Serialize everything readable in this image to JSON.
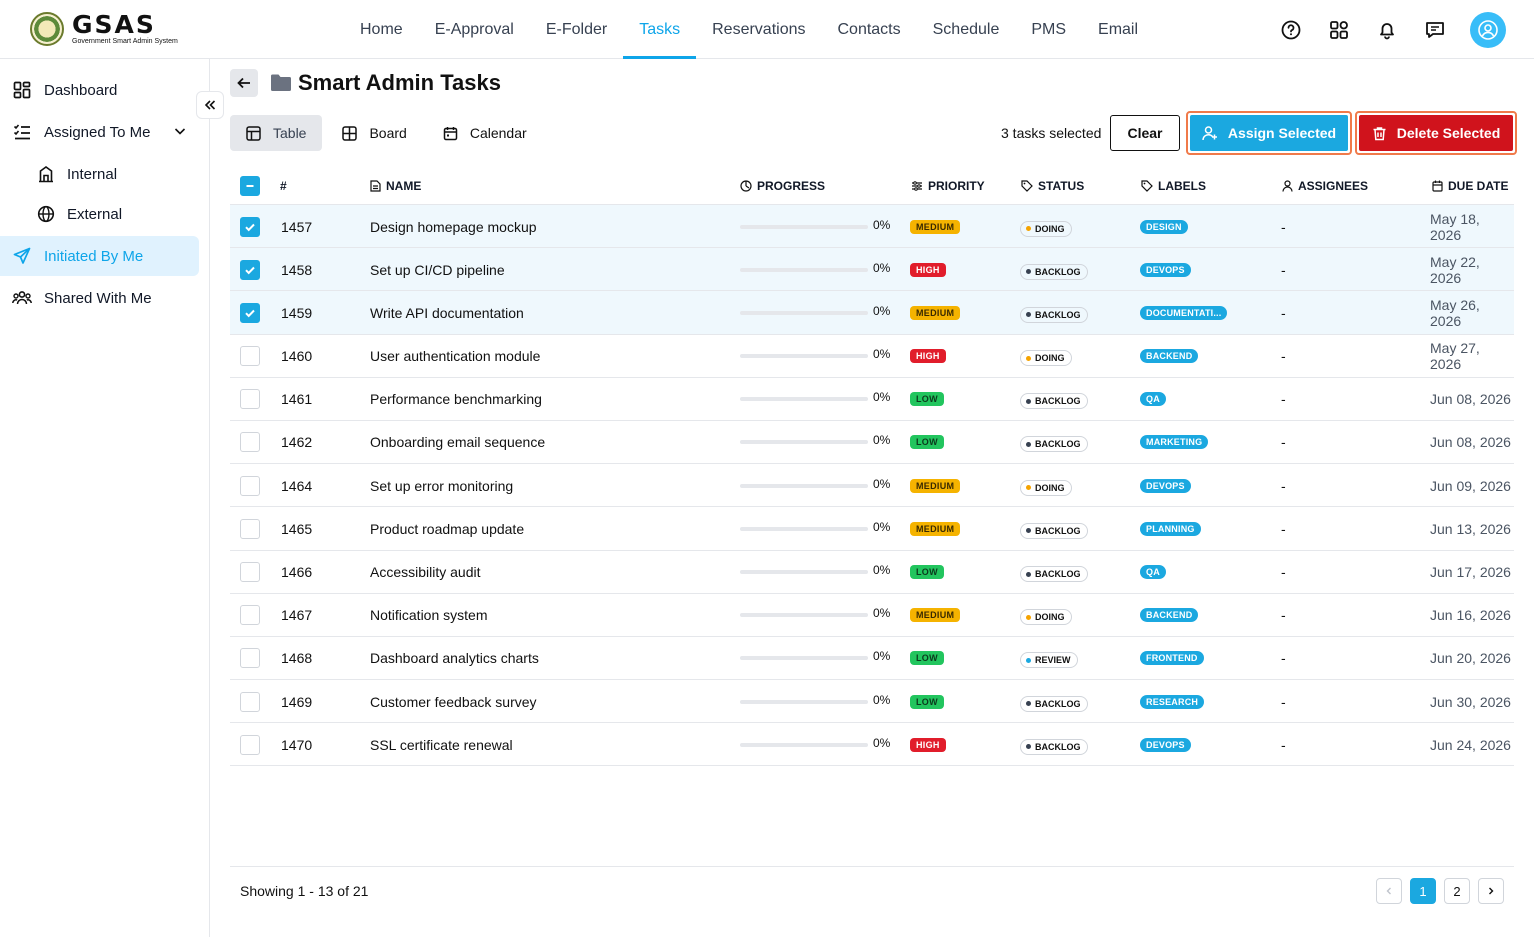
{
  "app": {
    "logo_main": "GSAS",
    "logo_sub": "Government Smart Admin System"
  },
  "nav": [
    "Home",
    "E-Approval",
    "E-Folder",
    "Tasks",
    "Reservations",
    "Contacts",
    "Schedule",
    "PMS",
    "Email"
  ],
  "nav_active": "Tasks",
  "sidebar": {
    "items": [
      {
        "label": "Dashboard",
        "icon": "grid-icon"
      },
      {
        "label": "Assigned To Me",
        "icon": "list-check-icon"
      },
      {
        "label": "Internal",
        "icon": "building-icon"
      },
      {
        "label": "External",
        "icon": "globe-icon"
      },
      {
        "label": "Initiated By Me",
        "icon": "send-icon"
      },
      {
        "label": "Shared With Me",
        "icon": "users-icon"
      }
    ],
    "active": "Initiated By Me"
  },
  "page": {
    "title": "Smart Admin Tasks",
    "views": [
      "Table",
      "Board",
      "Calendar"
    ],
    "active_view": "Table",
    "selected_text": "3 tasks selected",
    "clear_label": "Clear",
    "assign_label": "Assign Selected",
    "delete_label": "Delete Selected"
  },
  "table": {
    "headers": {
      "num": "#",
      "name": "NAME",
      "progress": "PROGRESS",
      "priority": "PRIORITY",
      "status": "STATUS",
      "labels": "LABELS",
      "assignees": "ASSIGNEES",
      "due": "DUE DATE"
    },
    "rows": [
      {
        "id": "1457",
        "name": "Design homepage mockup",
        "progress": "0%",
        "priority": "MEDIUM",
        "status": "DOING",
        "label": "DESIGN",
        "assignees": "-",
        "due": "May 18, 2026",
        "selected": true
      },
      {
        "id": "1458",
        "name": "Set up CI/CD pipeline",
        "progress": "0%",
        "priority": "HIGH",
        "status": "BACKLOG",
        "label": "DEVOPS",
        "assignees": "-",
        "due": "May 22, 2026",
        "selected": true
      },
      {
        "id": "1459",
        "name": "Write API documentation",
        "progress": "0%",
        "priority": "MEDIUM",
        "status": "BACKLOG",
        "label": "DOCUMENTATI...",
        "assignees": "-",
        "due": "May 26, 2026",
        "selected": true
      },
      {
        "id": "1460",
        "name": "User authentication module",
        "progress": "0%",
        "priority": "HIGH",
        "status": "DOING",
        "label": "BACKEND",
        "assignees": "-",
        "due": "May 27, 2026",
        "selected": false
      },
      {
        "id": "1461",
        "name": "Performance benchmarking",
        "progress": "0%",
        "priority": "LOW",
        "status": "BACKLOG",
        "label": "QA",
        "assignees": "-",
        "due": "Jun 08, 2026",
        "selected": false
      },
      {
        "id": "1462",
        "name": "Onboarding email sequence",
        "progress": "0%",
        "priority": "LOW",
        "status": "BACKLOG",
        "label": "MARKETING",
        "assignees": "-",
        "due": "Jun 08, 2026",
        "selected": false
      },
      {
        "id": "1464",
        "name": "Set up error monitoring",
        "progress": "0%",
        "priority": "MEDIUM",
        "status": "DOING",
        "label": "DEVOPS",
        "assignees": "-",
        "due": "Jun 09, 2026",
        "selected": false
      },
      {
        "id": "1465",
        "name": "Product roadmap update",
        "progress": "0%",
        "priority": "MEDIUM",
        "status": "BACKLOG",
        "label": "PLANNING",
        "assignees": "-",
        "due": "Jun 13, 2026",
        "selected": false
      },
      {
        "id": "1466",
        "name": "Accessibility audit",
        "progress": "0%",
        "priority": "LOW",
        "status": "BACKLOG",
        "label": "QA",
        "assignees": "-",
        "due": "Jun 17, 2026",
        "selected": false
      },
      {
        "id": "1467",
        "name": "Notification system",
        "progress": "0%",
        "priority": "MEDIUM",
        "status": "DOING",
        "label": "BACKEND",
        "assignees": "-",
        "due": "Jun 16, 2026",
        "selected": false
      },
      {
        "id": "1468",
        "name": "Dashboard analytics charts",
        "progress": "0%",
        "priority": "LOW",
        "status": "REVIEW",
        "label": "FRONTEND",
        "assignees": "-",
        "due": "Jun 20, 2026",
        "selected": false
      },
      {
        "id": "1469",
        "name": "Customer feedback survey",
        "progress": "0%",
        "priority": "LOW",
        "status": "BACKLOG",
        "label": "RESEARCH",
        "assignees": "-",
        "due": "Jun 30, 2026",
        "selected": false
      },
      {
        "id": "1470",
        "name": "SSL certificate renewal",
        "progress": "0%",
        "priority": "HIGH",
        "status": "BACKLOG",
        "label": "DEVOPS",
        "assignees": "-",
        "due": "Jun 24, 2026",
        "selected": false
      }
    ]
  },
  "footer": {
    "showing": "Showing 1 - 13 of 21",
    "pages": [
      "1",
      "2"
    ],
    "active_page": "1"
  },
  "colors": {
    "accent": "#1ba8e0",
    "danger": "#d0131c",
    "status_doing": "#f5a300",
    "status_backlog": "#374151",
    "status_review": "#1ba8e0"
  }
}
